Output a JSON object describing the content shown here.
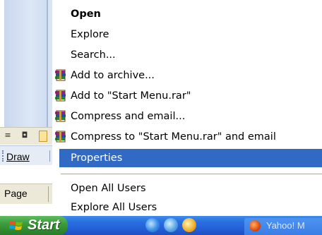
{
  "context_menu": {
    "items": [
      {
        "label": "Open",
        "bold": true
      },
      {
        "label": "Explore"
      },
      {
        "label": "Search..."
      },
      {
        "label": "Add to archive...",
        "icon": "winrar-books-icon"
      },
      {
        "label": "Add to \"Start Menu.rar\"",
        "icon": "winrar-books-icon"
      },
      {
        "label": "Compress and email...",
        "icon": "winrar-books-icon"
      },
      {
        "label": "Compress to \"Start Menu.rar\" and email",
        "icon": "winrar-books-icon"
      },
      {
        "label": "Properties",
        "highlighted": true
      },
      {
        "label": "Open All Users"
      },
      {
        "label": "Explore All Users"
      }
    ]
  },
  "background_app": {
    "draw_toolbar_label": "Draw",
    "status_page_label": "Page",
    "view_icons": [
      "normal-view-icon",
      "outline-view-icon",
      "slide-view-icon"
    ]
  },
  "taskbar": {
    "start_label": "Start",
    "quick_launch_icons": [
      "internet-explorer-icon",
      "outlook-express-icon",
      "media-player-icon"
    ],
    "task_button_label": "Yahoo! M",
    "colors": {
      "taskbar_blue": "#245ed8",
      "start_green": "#3d9c3d",
      "highlight_blue": "#316ac5"
    }
  }
}
